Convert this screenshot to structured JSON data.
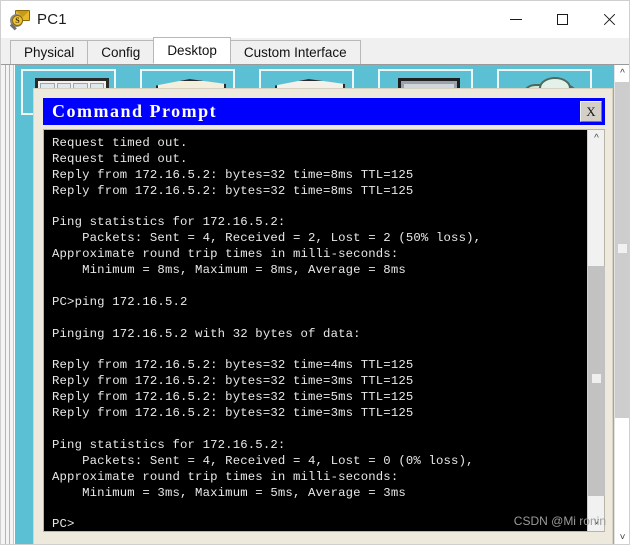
{
  "window": {
    "title": "PC1",
    "icon": "pc-device-icon",
    "icon_badge": "S",
    "controls": {
      "minimize": "minimize-icon",
      "maximize": "maximize-icon",
      "close": "close-icon"
    }
  },
  "tabs": [
    {
      "label": "Physical",
      "active": false
    },
    {
      "label": "Config",
      "active": false
    },
    {
      "label": "Desktop",
      "active": true
    },
    {
      "label": "Custom Interface",
      "active": false
    }
  ],
  "desktop": {
    "background_color": "#5bc0d4",
    "icons": [
      {
        "name": "ip-configuration-icon"
      },
      {
        "name": "dial-up-icon"
      },
      {
        "name": "terminal-icon"
      },
      {
        "name": "command-prompt-icon"
      },
      {
        "name": "web-browser-icon"
      },
      {
        "name": "pc-wireless-icon"
      }
    ]
  },
  "command_prompt": {
    "title": "Command Prompt",
    "close_label": "X",
    "background_color": "#000000",
    "text_color": "#e8e8e8",
    "titlebar_color": "#0000ff",
    "lines": [
      "Request timed out.",
      "Request timed out.",
      "Reply from 172.16.5.2: bytes=32 time=8ms TTL=125",
      "Reply from 172.16.5.2: bytes=32 time=8ms TTL=125",
      "",
      "Ping statistics for 172.16.5.2:",
      "    Packets: Sent = 4, Received = 2, Lost = 2 (50% loss),",
      "Approximate round trip times in milli-seconds:",
      "    Minimum = 8ms, Maximum = 8ms, Average = 8ms",
      "",
      "PC>ping 172.16.5.2",
      "",
      "Pinging 172.16.5.2 with 32 bytes of data:",
      "",
      "Reply from 172.16.5.2: bytes=32 time=4ms TTL=125",
      "Reply from 172.16.5.2: bytes=32 time=3ms TTL=125",
      "Reply from 172.16.5.2: bytes=32 time=5ms TTL=125",
      "Reply from 172.16.5.2: bytes=32 time=3ms TTL=125",
      "",
      "Ping statistics for 172.16.5.2:",
      "    Packets: Sent = 4, Received = 4, Lost = 0 (0% loss),",
      "Approximate round trip times in milli-seconds:",
      "    Minimum = 3ms, Maximum = 5ms, Average = 3ms",
      "",
      "PC>"
    ],
    "scrollbar": {
      "up_arrow": "chevron-up-icon",
      "down_arrow": "chevron-down-icon"
    }
  },
  "page_scrollbar": {
    "up_arrow": "chevron-up-icon",
    "down_arrow": "chevron-down-icon"
  },
  "watermark": "CSDN @Mi ronin"
}
